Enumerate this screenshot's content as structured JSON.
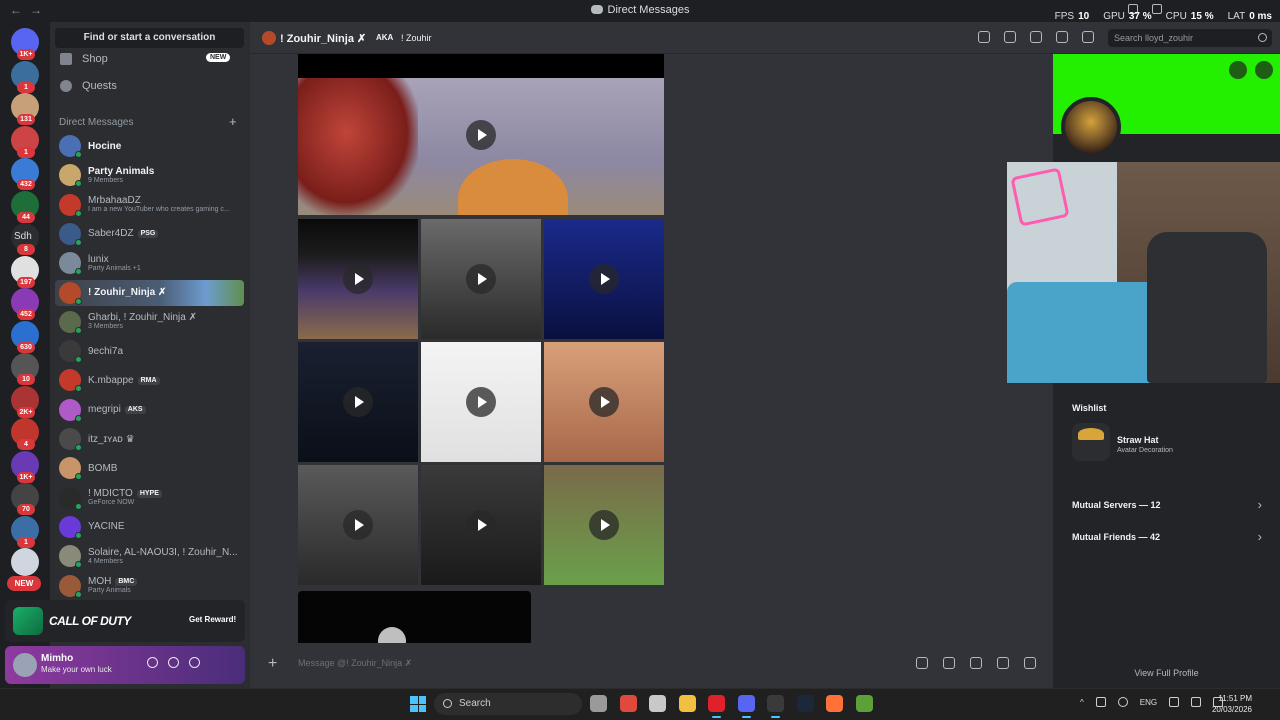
{
  "window": {
    "title": "Direct Messages",
    "stats": [
      {
        "k": "FPS",
        "v": "10"
      },
      {
        "k": "GPU",
        "v": "37 %"
      },
      {
        "k": "CPU",
        "v": "15 %"
      },
      {
        "k": "LAT",
        "v": "0 ms"
      }
    ]
  },
  "servers": [
    {
      "badge": "1K+",
      "color": "#5865f2"
    },
    {
      "badge": "1",
      "color": "#3c6e9c"
    },
    {
      "badge": "131",
      "color": "#c7a07a"
    },
    {
      "badge": "1",
      "color": "#c44"
    },
    {
      "badge": "432",
      "color": "#3a7bd5"
    },
    {
      "badge": "44",
      "color": "#1e6e3a"
    },
    {
      "badge": "8",
      "color": "#2b2d31",
      "label": "Sdh"
    },
    {
      "badge": "197",
      "color": "#e0e0e0"
    },
    {
      "badge": "452",
      "color": "#8a3ab5"
    },
    {
      "badge": "630",
      "color": "#2b6fd0"
    },
    {
      "badge": "10",
      "color": "#555"
    },
    {
      "badge": "2K+",
      "color": "#a33"
    },
    {
      "badge": "4",
      "color": "#c0362c"
    },
    {
      "badge": "1K+",
      "color": "#6a3ab5"
    },
    {
      "badge": "70",
      "color": "#444"
    },
    {
      "badge": "1",
      "color": "#3a6ea5"
    },
    {
      "badge": "",
      "color": "#cfd6e0"
    }
  ],
  "sidebar": {
    "find_placeholder": "Find or start a conversation",
    "shop_label": "Shop",
    "shop_badge": "NEW",
    "quests_label": "Quests",
    "dm_header": "Direct Messages",
    "new_badge": "NEW",
    "dms": [
      {
        "name": "Hocine",
        "sub": "",
        "tag": "",
        "color": "#4b6fb3",
        "bright": true
      },
      {
        "name": "Party Animals",
        "sub": "9 Members",
        "tag": "",
        "color": "#c9a66b",
        "bright": true
      },
      {
        "name": "MrbahaaDZ",
        "sub": "I am a new YouTuber who creates gaming c...",
        "tag": "",
        "color": "#c43a2a"
      },
      {
        "name": "Saber4DZ",
        "sub": "",
        "tag": "PSG",
        "color": "#3a5a8a"
      },
      {
        "name": "lunix",
        "sub": "Party Animals +1",
        "tag": "",
        "color": "#7a8a9a"
      },
      {
        "name": "! Zouhir_Ninja ✗",
        "sub": "",
        "tag": "",
        "color": "#b44a2a",
        "bright": true,
        "active": true
      },
      {
        "name": "Gharbi, ! Zouhir_Ninja ✗",
        "sub": "3 Members",
        "tag": "",
        "color": "#5a6a4a"
      },
      {
        "name": "9echi7a",
        "sub": "",
        "tag": "",
        "color": "#3a3a3a"
      },
      {
        "name": "K.mbappe",
        "sub": "",
        "tag": "RMA",
        "color": "#c43a2a"
      },
      {
        "name": "megripi",
        "sub": "",
        "tag": "AKS",
        "color": "#b05ac8"
      },
      {
        "name": "itz_ɪʏᴀᴅ ♛",
        "sub": "",
        "tag": "",
        "color": "#4a4a4a"
      },
      {
        "name": "BOMB",
        "sub": "",
        "tag": "",
        "color": "#c8946a"
      },
      {
        "name": "! MDICTO",
        "sub": "GeForce NOW",
        "tag": "HYPE",
        "color": "#2a2a2a"
      },
      {
        "name": "YACINE",
        "sub": "",
        "tag": "",
        "color": "#6a3ad8"
      },
      {
        "name": "Solaire, AL-NAOU3I, ! Zouhir_N...",
        "sub": "4 Members",
        "tag": "",
        "color": "#8a8a7a"
      },
      {
        "name": "MOH",
        "sub": "Party Animals",
        "tag": "BMC",
        "color": "#9a5a3a"
      }
    ],
    "promo_brand": "CALL OF DUTY",
    "promo_button": "Get Reward!",
    "user_name": "Mimho",
    "user_status": "Make your own luck"
  },
  "chat": {
    "recipient": "! Zouhir_Ninja ✗",
    "aka_label": "AKA",
    "aka_value": "! Zouhir",
    "search_placeholder": "Search lloyd_zouhir",
    "input_placeholder": "Message @! Zouhir_Ninja ✗",
    "thumbs": [
      {
        "bg": "linear-gradient(180deg,#0a0a0a 0%,#1c1c1c 30%,#4a3a6a 60%,#8a6a4a 100%)"
      },
      {
        "bg": "linear-gradient(180deg,#6a6a6a,#2a2a2a)"
      },
      {
        "bg": "linear-gradient(180deg,#1a2a8a,#0a1040)"
      },
      {
        "bg": "linear-gradient(180deg,#1a2030,#0a0f18)"
      },
      {
        "bg": "linear-gradient(180deg,#f4f4f4,#e0e0e0)"
      },
      {
        "bg": "linear-gradient(180deg,#d8a07a,#a8684a)"
      },
      {
        "bg": "linear-gradient(180deg,#5a5a5a,#2a2a2a)"
      },
      {
        "bg": "linear-gradient(180deg,#3a3a3a,#1a1a1a)"
      },
      {
        "bg": "linear-gradient(180deg,#7a6a4a,#6aa04a)"
      }
    ]
  },
  "profile": {
    "wishlist_title": "Wishlist",
    "wish_item": "Straw Hat",
    "wish_sub": "Avatar Decoration",
    "mutual_servers": "Mutual Servers — 12",
    "mutual_friends": "Mutual Friends — 42",
    "view_full": "View Full Profile"
  },
  "taskbar": {
    "search_label": "Search",
    "tray_lang": "ENG",
    "time": "11:51 PM",
    "date": "20/03/2026",
    "apps": [
      {
        "name": "task-view-app",
        "color": "#9a9a9a"
      },
      {
        "name": "chrome-app",
        "color": "#e04a3a"
      },
      {
        "name": "capture-app",
        "color": "#c8c8c8"
      },
      {
        "name": "file-explorer-app",
        "color": "#f0c040"
      },
      {
        "name": "opera-app",
        "color": "#e0202a"
      },
      {
        "name": "discord-app",
        "color": "#5865f2"
      },
      {
        "name": "obs-app",
        "color": "#3a3a3a"
      },
      {
        "name": "steam-app",
        "color": "#1b2838"
      },
      {
        "name": "firefox-app",
        "color": "#ff7139"
      },
      {
        "name": "minecraft-app",
        "color": "#5ca03a"
      }
    ]
  }
}
